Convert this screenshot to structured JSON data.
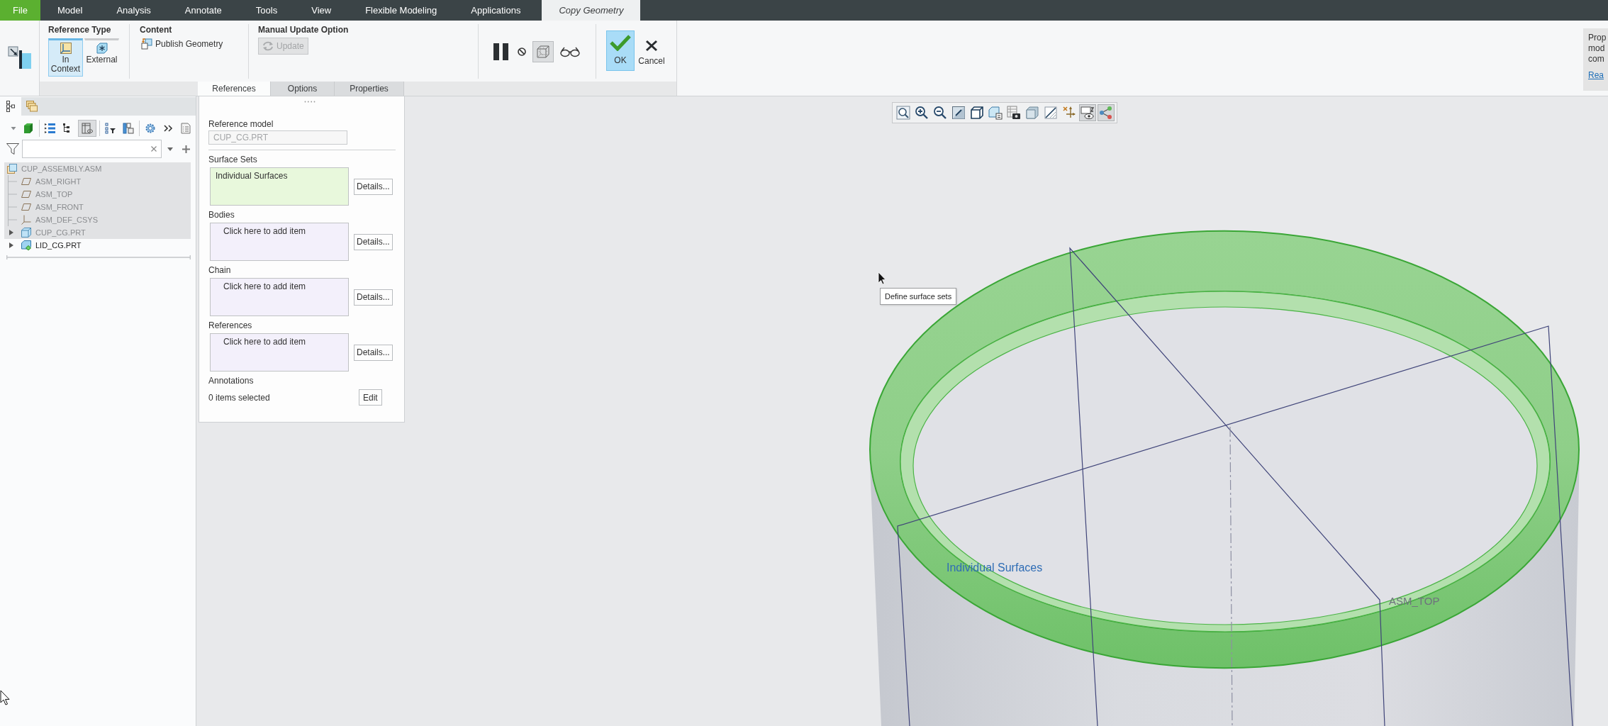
{
  "menu_tabs": [
    {
      "label": "File",
      "kind": "file",
      "selected": false
    },
    {
      "label": "Model",
      "kind": "tab",
      "selected": false
    },
    {
      "label": "Analysis",
      "kind": "tab",
      "selected": false
    },
    {
      "label": "Annotate",
      "kind": "tab",
      "selected": false
    },
    {
      "label": "Tools",
      "kind": "tab",
      "selected": false
    },
    {
      "label": "View",
      "kind": "tab",
      "selected": false
    },
    {
      "label": "Flexible Modeling",
      "kind": "tab",
      "selected": false
    },
    {
      "label": "Applications",
      "kind": "tab",
      "selected": false
    },
    {
      "label": "Copy Geometry",
      "kind": "tab",
      "selected": true
    }
  ],
  "ribbon": {
    "reference_type": {
      "title": "Reference Type",
      "options": [
        {
          "label": "In Context",
          "kind": "in-context",
          "selected": true
        },
        {
          "label": "External",
          "kind": "external",
          "selected": false
        }
      ]
    },
    "content": {
      "title": "Content",
      "button": "Publish Geometry"
    },
    "manual_update": {
      "title": "Manual Update Option",
      "button": "Update",
      "disabled": true
    },
    "tools": [
      {
        "kind": "pause",
        "pressed": false
      },
      {
        "kind": "no-entry",
        "pressed": false
      },
      {
        "kind": "preview",
        "pressed": true
      },
      {
        "kind": "glasses",
        "pressed": false
      }
    ],
    "ok": "OK",
    "cancel": "Cancel"
  },
  "dialog_tabs": [
    {
      "label": "References",
      "selected": true
    },
    {
      "label": "Options",
      "selected": false
    },
    {
      "label": "Properties",
      "selected": false
    }
  ],
  "notification": {
    "lines": [
      "Prop",
      "mod",
      "com"
    ],
    "link": "Rea"
  },
  "left_panel": {
    "tabs": [
      {
        "kind": "model-tree",
        "selected": true
      },
      {
        "kind": "layers",
        "selected": false
      }
    ],
    "toolbar_groups": [
      {
        "items": [
          {
            "kind": "dropdown",
            "pressed": false
          },
          {
            "kind": "display-cube",
            "pressed": false
          }
        ]
      },
      {
        "items": [
          {
            "kind": "tree-list",
            "pressed": false
          },
          {
            "kind": "tree-expand",
            "pressed": false
          },
          {
            "kind": "columns-view",
            "pressed": true
          }
        ]
      },
      {
        "items": [
          {
            "kind": "tree-filter",
            "pressed": false
          },
          {
            "kind": "tree-columns",
            "pressed": false
          }
        ]
      },
      {
        "items": [
          {
            "kind": "settings",
            "pressed": false
          },
          {
            "kind": "more",
            "pressed": false
          },
          {
            "kind": "notes",
            "pressed": false
          }
        ]
      }
    ],
    "tree": [
      {
        "label": "CUP_ASSEMBLY.ASM",
        "kind": "assembly",
        "dimmed": true,
        "children": [
          {
            "label": "ASM_RIGHT",
            "kind": "plane",
            "dimmed": true
          },
          {
            "label": "ASM_TOP",
            "kind": "plane",
            "dimmed": true
          },
          {
            "label": "ASM_FRONT",
            "kind": "plane",
            "dimmed": true
          },
          {
            "label": "ASM_DEF_CSYS",
            "kind": "csys",
            "dimmed": true
          },
          {
            "label": "CUP_CG.PRT",
            "kind": "part",
            "dimmed": true,
            "expanded": false
          },
          {
            "label": "LID_CG.PRT",
            "kind": "active-part",
            "dimmed": false,
            "expanded": false
          }
        ]
      }
    ]
  },
  "references_panel": {
    "reference_model": {
      "label": "Reference model",
      "value": "CUP_CG.PRT",
      "disabled": true
    },
    "collectors": [
      {
        "label": "Surface Sets",
        "entry": "Individual Surfaces",
        "active": true,
        "button": "Details..."
      },
      {
        "label": "Bodies",
        "entry": "Click here to add item",
        "active": false,
        "button": "Details..."
      },
      {
        "label": "Chain",
        "entry": "Click here to add item",
        "active": false,
        "button": "Details..."
      },
      {
        "label": "References",
        "entry": "Click here to add item",
        "active": false,
        "button": "Details..."
      }
    ],
    "annotations": {
      "label": "Annotations",
      "status": "0 items selected",
      "button": "Edit"
    }
  },
  "viewport": {
    "toolbar": [
      {
        "kind": "refit",
        "pressed": false
      },
      {
        "kind": "zoom-in",
        "pressed": false
      },
      {
        "kind": "zoom-out",
        "pressed": false
      },
      {
        "kind": "repaint",
        "pressed": false
      },
      {
        "kind": "orientation",
        "pressed": false
      },
      {
        "kind": "saved-views",
        "pressed": false
      },
      {
        "kind": "snapshot",
        "pressed": false
      },
      {
        "kind": "display-style",
        "pressed": false
      },
      {
        "kind": "section",
        "pressed": false
      },
      {
        "kind": "datum-display",
        "pressed": false
      },
      {
        "kind": "annotation-display",
        "pressed": true
      },
      {
        "kind": "spin-center",
        "pressed": true
      }
    ],
    "tooltip": "Define surface sets",
    "labels": [
      {
        "text": "Individual Surfaces",
        "kind": "selection"
      },
      {
        "text": "ASM_TOP",
        "kind": "datum"
      }
    ]
  }
}
